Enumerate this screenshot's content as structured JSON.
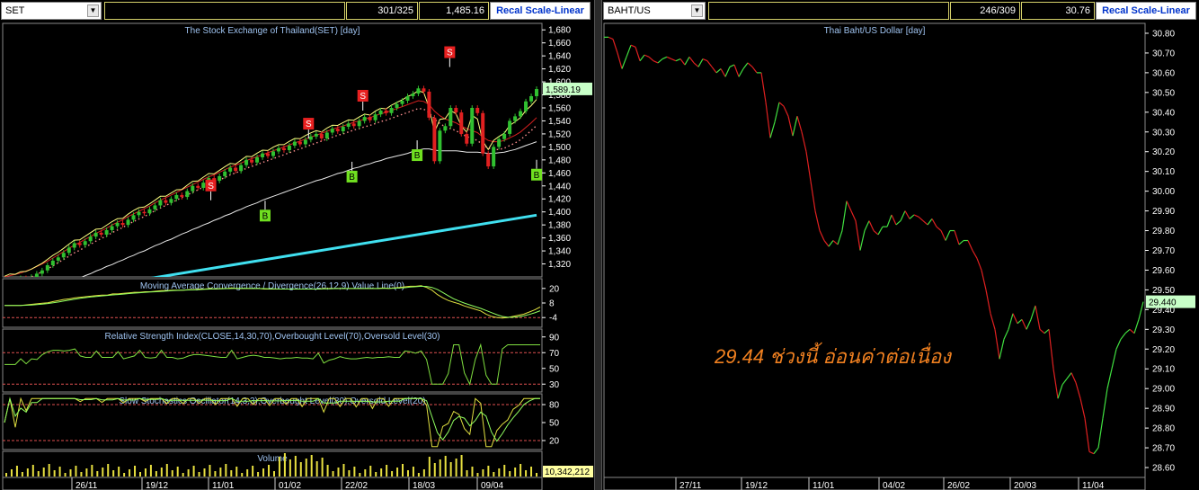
{
  "left": {
    "symbol": "SET",
    "position": "301/325",
    "last_value": "1,485.16",
    "recal_label": "Recal Scale-Linear",
    "chart_title": "The Stock Exchange of Thailand(SET) [day]",
    "price_label": "1,589.19",
    "macd_title": "Moving Average Convergence / Divergence(26,12,9) Value Line(0)",
    "rsi_title": "Relative Strength Index(CLOSE,14,30,70),Overbought Level(70),Oversold Level(30)",
    "stoch_title": "Slow Stochastics Oscillator(14,3,3),Overbought Level(80),Oversold Level(20)",
    "volume_title": "Volume",
    "volume_label": "10,342,212"
  },
  "right": {
    "symbol": "BAHT/US",
    "position": "246/309",
    "last_value": "30.76",
    "recal_label": "Recal Scale-Linear",
    "chart_title": "Thai Baht/US Dollar [day]",
    "price_label": "29.440",
    "annotation": "29.44 ช่วงนี้ อ่อนค่าต่อเนื่อง"
  },
  "chart_data": [
    {
      "type": "candlestick",
      "title": "The Stock Exchange of Thailand(SET) [day]",
      "ylim": [
        1300,
        1690
      ],
      "yticks": [
        1320,
        1340,
        1360,
        1380,
        1400,
        1420,
        1440,
        1460,
        1480,
        1500,
        1520,
        1540,
        1560,
        1580,
        1600,
        1620,
        1640,
        1660,
        1680
      ],
      "xtick_labels": [
        "26/11",
        "19/12",
        "11/01",
        "01/02",
        "22/02",
        "18/03",
        "09/04"
      ],
      "close": [
        1290,
        1295,
        1292,
        1298,
        1296,
        1300,
        1305,
        1310,
        1318,
        1325,
        1330,
        1337,
        1345,
        1352,
        1349,
        1355,
        1362,
        1368,
        1365,
        1372,
        1378,
        1383,
        1380,
        1388,
        1395,
        1400,
        1398,
        1404,
        1410,
        1418,
        1414,
        1420,
        1426,
        1423,
        1432,
        1440,
        1437,
        1445,
        1452,
        1448,
        1455,
        1462,
        1468,
        1463,
        1472,
        1480,
        1476,
        1484,
        1490,
        1486,
        1493,
        1498,
        1495,
        1502,
        1508,
        1504,
        1511,
        1516,
        1520,
        1513,
        1522,
        1528,
        1524,
        1531,
        1536,
        1532,
        1540,
        1546,
        1541,
        1550,
        1556,
        1552,
        1560,
        1566,
        1571,
        1578,
        1582,
        1590,
        1585,
        1545,
        1478,
        1525,
        1532,
        1560,
        1553,
        1520,
        1505,
        1560,
        1552,
        1490,
        1470,
        1500,
        1512,
        1520,
        1540,
        1547,
        1555,
        1570,
        1578,
        1589
      ],
      "ema_fast": [
        1300,
        1302,
        1304,
        1306,
        1309,
        1312,
        1316,
        1320,
        1324,
        1329,
        1334,
        1339,
        1344,
        1349,
        1353,
        1358,
        1362,
        1367,
        1371,
        1375,
        1380,
        1384,
        1388,
        1393,
        1397,
        1401,
        1405,
        1409,
        1414,
        1418,
        1422,
        1426,
        1430,
        1434,
        1438,
        1442,
        1446,
        1450,
        1454,
        1457,
        1461,
        1465,
        1469,
        1472,
        1475,
        1479,
        1482,
        1485,
        1488,
        1491,
        1494,
        1497,
        1500,
        1503,
        1506,
        1509,
        1512,
        1515,
        1518,
        1521,
        1524,
        1527,
        1530,
        1532,
        1535,
        1538,
        1540,
        1543,
        1545,
        1548,
        1551,
        1553,
        1556,
        1559,
        1562,
        1565,
        1568,
        1571,
        1570,
        1565,
        1555,
        1548,
        1543,
        1540,
        1537,
        1532,
        1528,
        1525,
        1522,
        1515,
        1510,
        1508,
        1508,
        1510,
        1514,
        1518,
        1523,
        1530,
        1537,
        1545
      ],
      "ema_slow": [
        1260,
        1262,
        1264,
        1266,
        1268,
        1270,
        1273,
        1276,
        1279,
        1282,
        1285,
        1288,
        1292,
        1295,
        1298,
        1302,
        1305,
        1309,
        1312,
        1316,
        1319,
        1323,
        1326,
        1330,
        1333,
        1337,
        1340,
        1344,
        1348,
        1351,
        1355,
        1358,
        1362,
        1366,
        1369,
        1373,
        1376,
        1380,
        1383,
        1387,
        1390,
        1394,
        1397,
        1401,
        1404,
        1408,
        1411,
        1414,
        1418,
        1421,
        1424,
        1427,
        1430,
        1433,
        1436,
        1439,
        1442,
        1445,
        1448,
        1450,
        1453,
        1456,
        1459,
        1461,
        1464,
        1467,
        1469,
        1472,
        1474,
        1477,
        1479,
        1482,
        1484,
        1486,
        1488,
        1490,
        1493,
        1495,
        1497,
        1497,
        1495,
        1494,
        1494,
        1494,
        1494,
        1493,
        1492,
        1492,
        1492,
        1491,
        1490,
        1490,
        1491,
        1492,
        1494,
        1496,
        1499,
        1502,
        1505,
        1508
      ],
      "long_ma_start": [
        14,
        1280
      ],
      "long_ma_end": [
        99,
        1395
      ],
      "sell_signals": [
        [
          19,
          1440
        ],
        [
          28,
          1535
        ],
        [
          33,
          1578
        ],
        [
          41,
          1645
        ]
      ],
      "buy_signals": [
        [
          24,
          1395
        ],
        [
          32,
          1455
        ],
        [
          38,
          1488
        ],
        [
          49,
          1458
        ]
      ],
      "legend": ""
    },
    {
      "type": "line",
      "title": "Thai Baht/US Dollar [day]",
      "ylim": [
        28.55,
        30.85
      ],
      "yticks": [
        28.6,
        28.7,
        28.8,
        28.9,
        29.0,
        29.1,
        29.2,
        29.3,
        29.4,
        29.5,
        29.6,
        29.7,
        29.8,
        29.9,
        30.0,
        30.1,
        30.2,
        30.3,
        30.4,
        30.5,
        30.6,
        30.7,
        30.8
      ],
      "xtick_labels": [
        "27/11",
        "19/12",
        "11/01",
        "04/02",
        "26/02",
        "20/03",
        "11/04"
      ],
      "values": [
        30.78,
        30.78,
        30.77,
        30.7,
        30.62,
        30.68,
        30.74,
        30.73,
        30.66,
        30.69,
        30.68,
        30.66,
        30.65,
        30.67,
        30.68,
        30.67,
        30.66,
        30.67,
        30.64,
        30.68,
        30.65,
        30.63,
        30.67,
        30.66,
        30.63,
        30.6,
        30.62,
        30.58,
        30.63,
        30.64,
        30.58,
        30.62,
        30.65,
        30.63,
        30.6,
        30.6,
        30.45,
        30.27,
        30.35,
        30.45,
        30.43,
        30.38,
        30.28,
        30.38,
        30.3,
        30.2,
        30.05,
        29.9,
        29.8,
        29.75,
        29.72,
        29.75,
        29.73,
        29.8,
        29.95,
        29.9,
        29.85,
        29.7,
        29.8,
        29.85,
        29.8,
        29.78,
        29.82,
        29.82,
        29.88,
        29.83,
        29.85,
        29.9,
        29.86,
        29.88,
        29.87,
        29.85,
        29.83,
        29.86,
        29.82,
        29.8,
        29.75,
        29.8,
        29.8,
        29.73,
        29.75,
        29.75,
        29.7,
        29.66,
        29.6,
        29.5,
        29.38,
        29.3,
        29.15,
        29.25,
        29.3,
        29.38,
        29.33,
        29.35,
        29.3,
        29.35,
        29.42,
        29.3,
        29.28,
        29.3,
        29.1,
        28.95,
        29.02,
        29.05,
        29.08,
        29.03,
        28.95,
        28.85,
        28.68,
        28.67,
        28.7,
        28.85,
        29.0,
        29.1,
        29.2,
        29.25,
        29.28,
        29.3,
        29.28,
        29.35,
        29.44
      ]
    }
  ]
}
